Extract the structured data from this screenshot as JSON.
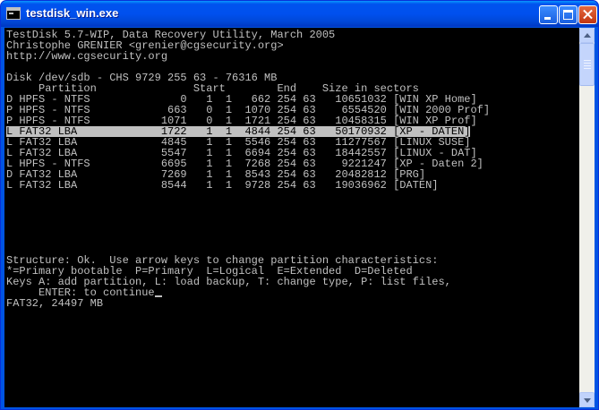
{
  "window": {
    "title": "testdisk_win.exe",
    "minimize_icon": "minimize-icon",
    "maximize_icon": "maximize-icon",
    "close_icon": "close-icon",
    "accent_color": "#0054e3"
  },
  "console": {
    "lines": [
      "TestDisk 5.7-WIP, Data Recovery Utility, March 2005",
      "Christophe GRENIER <grenier@cgsecurity.org>",
      "http://www.cgsecurity.org",
      "",
      "Disk /dev/sdb - CHS 9729 255 63 - 76316 MB",
      "     Partition               Start        End    Size in sectors",
      "D HPFS - NTFS              0   1  1   662 254 63   10651032 [WIN XP Home]",
      "P HPFS - NTFS            663   0  1  1070 254 63    6554520 [WIN 2000 Prof]",
      "P HPFS - NTFS           1071   0  1  1721 254 63   10458315 [WIN XP Prof]",
      "L FAT32 LBA             1722   1  1  4844 254 63   50170932 [XP - DATEN]",
      "L FAT32 LBA             4845   1  1  5546 254 63   11277567 [LINUX SUSE]",
      "L FAT32 LBA             5547   1  1  6694 254 63   18442557 [LINUX - DAT]",
      "L HPFS - NTFS           6695   1  1  7268 254 63    9221247 [XP - Daten 2]",
      "D FAT32 LBA             7269   1  1  8543 254 63   20482812 [PRG]",
      "L FAT32 LBA             8544   1  1  9728 254 63   19036962 [DATEN]",
      "",
      "",
      "",
      "",
      "",
      "",
      "Structure: Ok.  Use arrow keys to change partition characteristics:",
      "*=Primary bootable  P=Primary  L=Logical  E=Extended  D=Deleted",
      "Keys A: add partition, L: load backup, T: change type, P: list files,",
      "     ENTER: to continue",
      "FAT32, 24497 MB"
    ],
    "highlighted_row": 9,
    "text_color": "#c0c0c0",
    "background_color": "#000000"
  }
}
